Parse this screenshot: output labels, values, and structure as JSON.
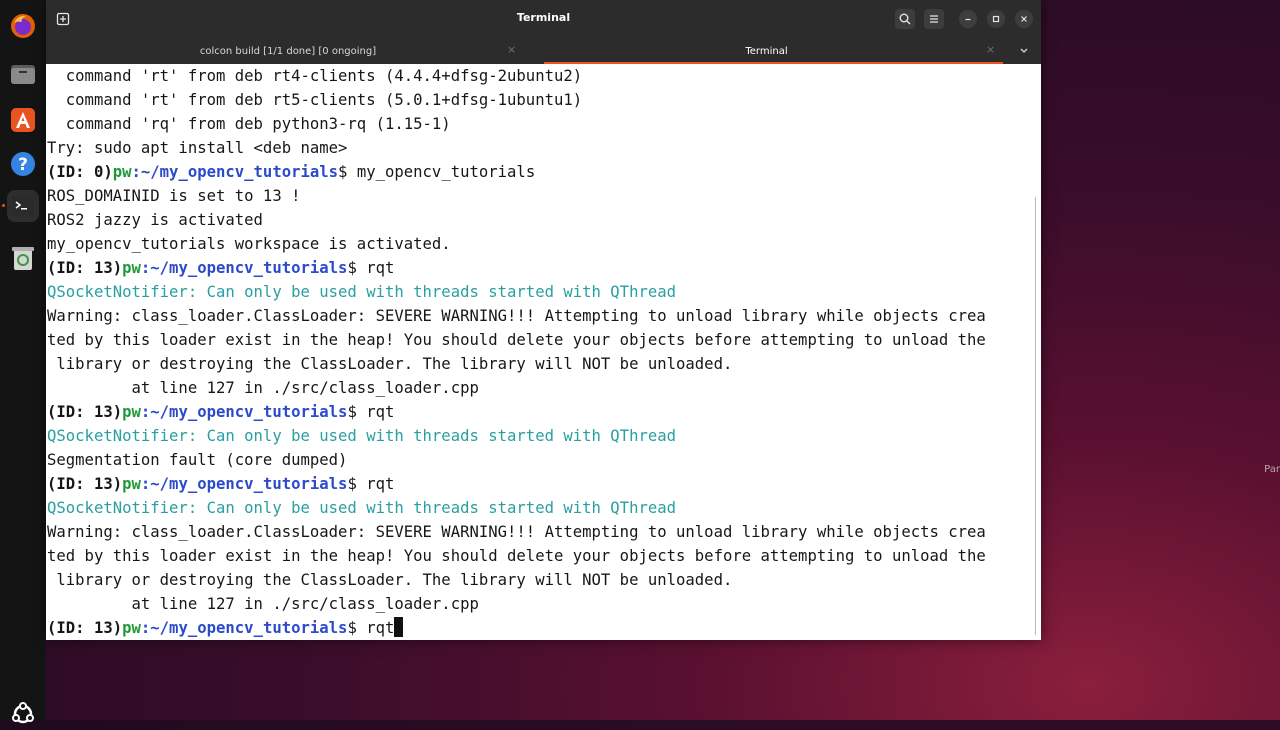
{
  "window": {
    "title": "Terminal"
  },
  "tabs": [
    {
      "label": "colcon build [1/1 done] [0 ongoing]"
    },
    {
      "label": "Terminal"
    }
  ],
  "edge_text": "Par",
  "prompt": {
    "id": "(ID: 13)",
    "id0": "(ID: 0)",
    "user": "pw",
    "path": ":~/my_opencv_tutorials",
    "dollar": "$ "
  },
  "lines": {
    "l1": "  command 'rt' from deb rt4-clients (4.4.4+dfsg-2ubuntu2)",
    "l2": "  command 'rt' from deb rt5-clients (5.0.1+dfsg-1ubuntu1)",
    "l3": "  command 'rq' from deb python3-rq (1.15-1)",
    "l4": "Try: sudo apt install <deb name>",
    "l5_cmd": "my_opencv_tutorials",
    "l6": "ROS_DOMAINID is set to 13 !",
    "l7": "ROS2 jazzy is activated",
    "l8": "my_opencv_tutorials workspace is activated.",
    "l9_cmd": "rqt",
    "l10": "QSocketNotifier: Can only be used with threads started with QThread",
    "l11": "Warning: class_loader.ClassLoader: SEVERE WARNING!!! Attempting to unload library while objects crea",
    "l12": "ted by this loader exist in the heap! You should delete your objects before attempting to unload the",
    "l13": " library or destroying the ClassLoader. The library will NOT be unloaded.",
    "l14": "         at line 127 in ./src/class_loader.cpp",
    "l15_cmd": "rqt",
    "l16": "QSocketNotifier: Can only be used with threads started with QThread",
    "l17": "Segmentation fault (core dumped)",
    "l18_cmd": "rqt",
    "l19": "QSocketNotifier: Can only be used with threads started with QThread",
    "l20": "Warning: class_loader.ClassLoader: SEVERE WARNING!!! Attempting to unload library while objects crea",
    "l21": "ted by this loader exist in the heap! You should delete your objects before attempting to unload the",
    "l22": " library or destroying the ClassLoader. The library will NOT be unloaded.",
    "l23": "         at line 127 in ./src/class_loader.cpp",
    "l24_cmd": "rqt"
  },
  "colors": {
    "accent": "#e95420",
    "prompt_user": "#1f9a3a",
    "prompt_path": "#2c4bc9",
    "notifier": "#2a9fa0"
  },
  "dock": [
    "firefox-icon",
    "files-icon",
    "app-center-icon",
    "help-icon",
    "terminal-icon",
    "trash-icon",
    "show-apps-icon"
  ]
}
